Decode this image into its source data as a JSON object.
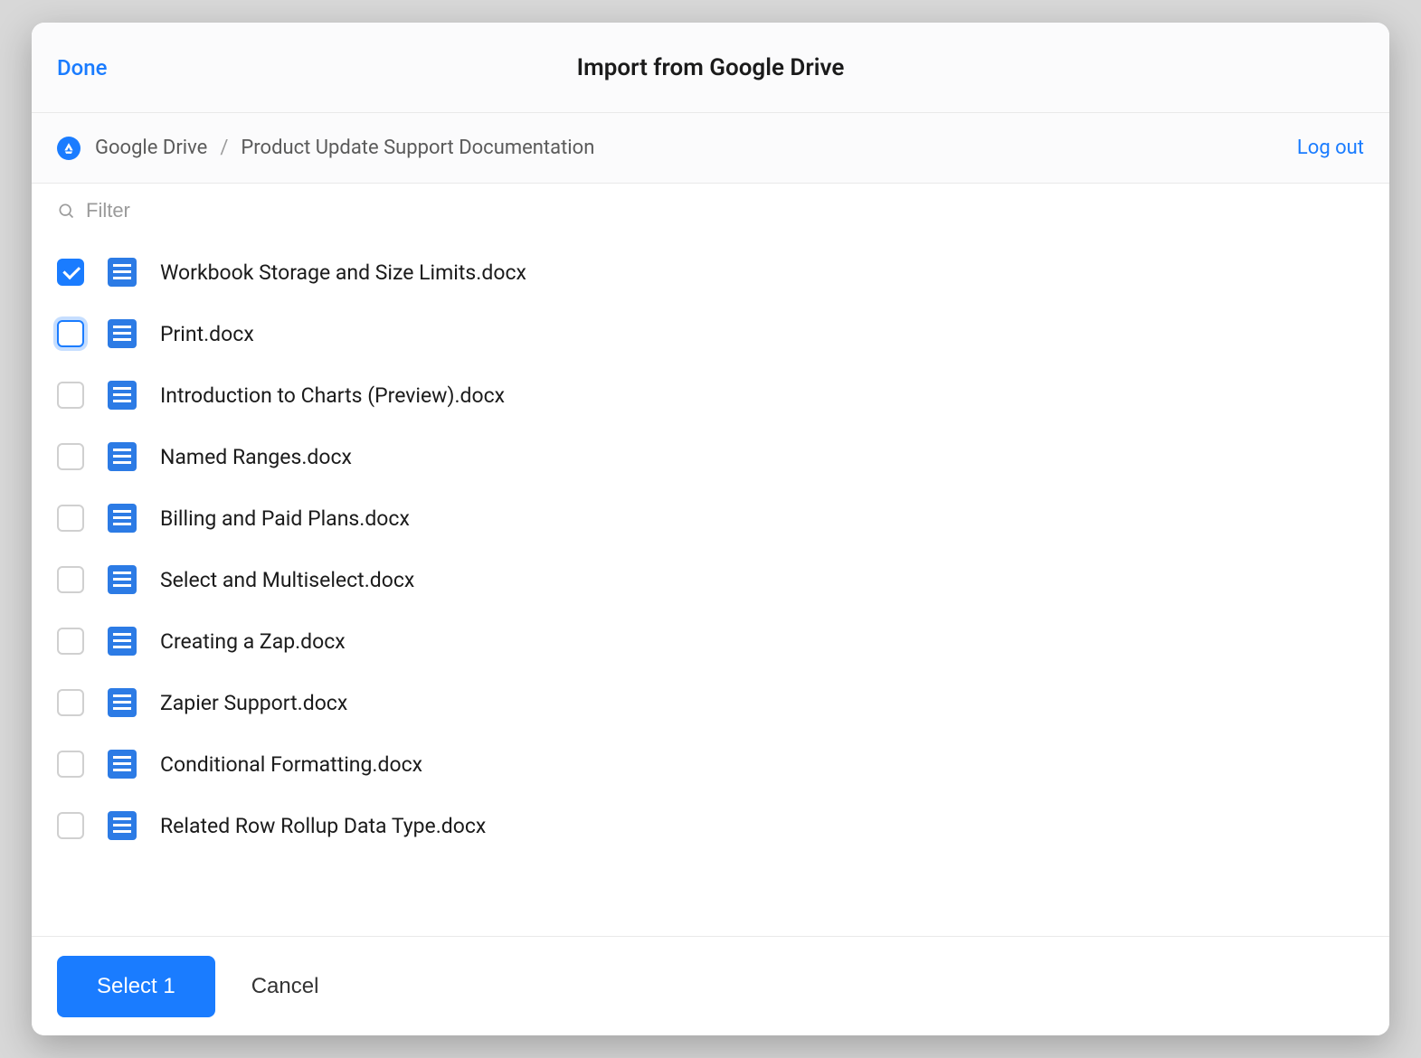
{
  "header": {
    "done_label": "Done",
    "title": "Import from Google Drive"
  },
  "breadcrumb": {
    "root": "Google Drive",
    "current": "Product Update Support Documentation",
    "logout_label": "Log out"
  },
  "filter": {
    "placeholder": "Filter",
    "value": ""
  },
  "files": [
    {
      "name": "Workbook Storage and Size Limits.docx",
      "checked": true,
      "focused": false
    },
    {
      "name": "Print.docx",
      "checked": false,
      "focused": true
    },
    {
      "name": "Introduction to Charts (Preview).docx",
      "checked": false,
      "focused": false
    },
    {
      "name": "Named Ranges.docx",
      "checked": false,
      "focused": false
    },
    {
      "name": "Billing and Paid Plans.docx",
      "checked": false,
      "focused": false
    },
    {
      "name": "Select and Multiselect.docx",
      "checked": false,
      "focused": false
    },
    {
      "name": "Creating a Zap.docx",
      "checked": false,
      "focused": false
    },
    {
      "name": "Zapier Support.docx",
      "checked": false,
      "focused": false
    },
    {
      "name": "Conditional Formatting.docx",
      "checked": false,
      "focused": false
    },
    {
      "name": "Related Row Rollup Data Type.docx",
      "checked": false,
      "focused": false
    }
  ],
  "footer": {
    "select_label": "Select 1",
    "cancel_label": "Cancel"
  }
}
